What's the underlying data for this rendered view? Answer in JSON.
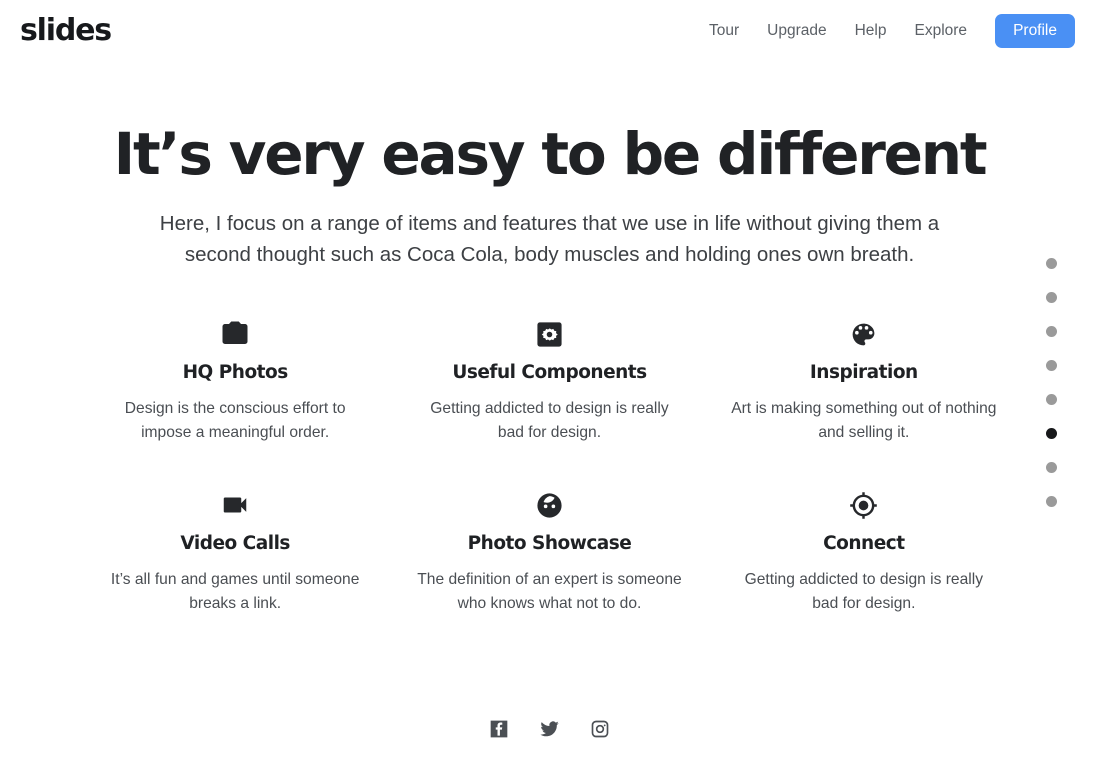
{
  "header": {
    "logo": "slides",
    "nav": [
      {
        "label": "Tour",
        "name": "nav-link-tour"
      },
      {
        "label": "Upgrade",
        "name": "nav-link-upgrade"
      },
      {
        "label": "Help",
        "name": "nav-link-help"
      },
      {
        "label": "Explore",
        "name": "nav-link-explore"
      }
    ],
    "profile_label": "Profile",
    "profile_color": "#4a90f4"
  },
  "hero": {
    "headline": "It’s very easy to be different",
    "subhead": "Here, I focus on a range of items and features that we use in life without giving them a second thought such as Coca Cola, body muscles and holding ones own breath."
  },
  "features": [
    {
      "icon": "camera-resize-icon",
      "title": "HQ Photos",
      "text": "Design is the conscious effort to impose a meaningful order."
    },
    {
      "icon": "settings-applications-icon",
      "title": "Useful Components",
      "text": "Getting addicted to design is really bad for design."
    },
    {
      "icon": "palette-icon",
      "title": "Inspiration",
      "text": "Art is making something out of nothing and selling it."
    },
    {
      "icon": "videocam-icon",
      "title": "Video Calls",
      "text": "It’s all fun and games until someone breaks a link."
    },
    {
      "icon": "face-icon",
      "title": "Photo Showcase",
      "text": "The definition of an expert is someone who knows what not to do."
    },
    {
      "icon": "my-location-icon",
      "title": "Connect",
      "text": "Getting addicted to design is really bad for design."
    }
  ],
  "pagination": {
    "total": 8,
    "active_index": 5,
    "dot_color": "#9a9a9a",
    "active_dot_color": "#17181a"
  },
  "footer": {
    "social": [
      {
        "name": "facebook-icon",
        "label": "Facebook"
      },
      {
        "name": "twitter-icon",
        "label": "Twitter"
      },
      {
        "name": "instagram-icon",
        "label": "Instagram"
      }
    ],
    "icon_color": "#4b4f54"
  }
}
